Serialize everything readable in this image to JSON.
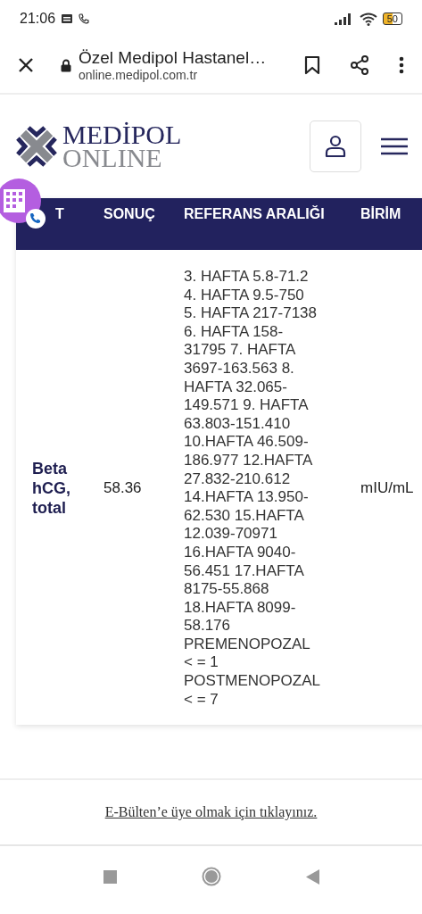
{
  "status_bar": {
    "time": "21:06",
    "battery": "50"
  },
  "browser": {
    "title": "Özel Medipol Hastanel…",
    "url": "online.medipol.com.tr"
  },
  "logo": {
    "line1": "MEDİPOL",
    "line2": "ONLINE"
  },
  "table": {
    "columns": [
      "T",
      "SONUÇ",
      "REFERANS ARALIĞI",
      "BİRİM"
    ],
    "rows": [
      {
        "test": "Beta hCG, total",
        "result": "58.36",
        "reference_lines": [
          "3. HAFTA 5.8-71.2",
          "4. HAFTA 9.5-750",
          "5. HAFTA 217-7138",
          "6. HAFTA 158-",
          "31795 7. HAFTA",
          "3697-163.563 8.",
          "HAFTA 32.065-",
          "149.571 9. HAFTA",
          "63.803-151.410",
          "10.HAFTA 46.509-",
          "186.977 12.HAFTA",
          "27.832-210.612",
          "14.HAFTA 13.950-",
          "62.530 15.HAFTA",
          "12.039-70971",
          "16.HAFTA 9040-",
          "56.451 17.HAFTA",
          "8175-55.868",
          "18.HAFTA 8099-",
          "58.176",
          "PREMENOPOZAL",
          "< = 1",
          "POSTMENOPOZAL",
          "< = 7"
        ],
        "unit": "mIU/mL"
      }
    ]
  },
  "footer": {
    "link": "E-Bülten’e üye olmak için tıklayınız."
  }
}
